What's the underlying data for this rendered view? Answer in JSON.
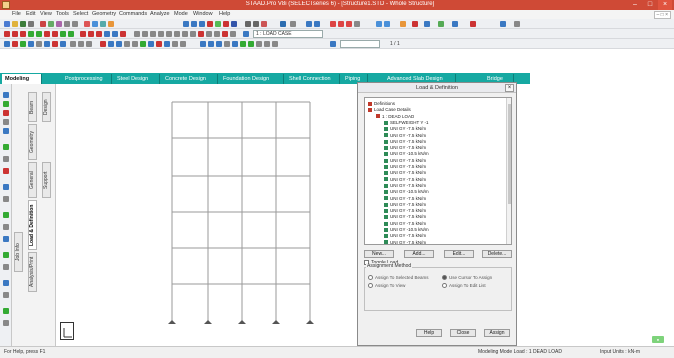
{
  "window": {
    "title": "STAAD.Pro V8i (SELECTseries 6) - [Structure1.STD - Whole Structure]",
    "controls": [
      "–",
      "□",
      "×"
    ]
  },
  "menubar": {
    "items": [
      "File",
      "Edit",
      "View",
      "Tools",
      "Select",
      "Geometry",
      "Commands",
      "Analyze",
      "Mode",
      "Window",
      "Help"
    ],
    "right_label": "– □ ×"
  },
  "toolbar": {
    "load_case_select": "1 : LOAD CASE",
    "page_select": "",
    "page_count": "1  /  1"
  },
  "tabs": {
    "items": [
      "Modeling",
      "Postprocessing",
      "Steel Design",
      "Concrete Design",
      "Foundation Design",
      "Shell Connection",
      "Piping",
      "Advanced Slab Design",
      "Bridge"
    ],
    "active_index": 0
  },
  "page_control": {
    "tabs": [
      "Job Info",
      "Beam",
      "Geometry",
      "General",
      "Support",
      "Load & Definition",
      "Analysis/Print",
      "Design"
    ],
    "active": "Load & Definition"
  },
  "dialog": {
    "title": "Load & Definition",
    "close": "×",
    "tree": [
      {
        "level": 0,
        "label": "Definitions",
        "icon": "folder"
      },
      {
        "level": 0,
        "label": "Load Case Details",
        "icon": "folder"
      },
      {
        "level": 1,
        "label": "1 : DEAD LOAD",
        "icon": "load"
      },
      {
        "level": 2,
        "label": "SELFWEIGHT Y -1",
        "icon": "check"
      },
      {
        "level": 2,
        "label": "UNI GY -7.5 kN/m",
        "icon": "check"
      },
      {
        "level": 2,
        "label": "UNI GY -7.5 kN/m",
        "icon": "check"
      },
      {
        "level": 2,
        "label": "UNI GY -7.5 kN/m",
        "icon": "check"
      },
      {
        "level": 2,
        "label": "UNI GY -7.5 kN/m",
        "icon": "check"
      },
      {
        "level": 2,
        "label": "UNI GY -10.5 kN/m",
        "icon": "check"
      },
      {
        "level": 2,
        "label": "UNI GY -7.5 kN/m",
        "icon": "check"
      },
      {
        "level": 2,
        "label": "UNI GY -7.5 kN/m",
        "icon": "check"
      },
      {
        "level": 2,
        "label": "UNI GY -7.5 kN/m",
        "icon": "check"
      },
      {
        "level": 2,
        "label": "UNI GY -7.5 kN/m",
        "icon": "check"
      },
      {
        "level": 2,
        "label": "UNI GY -7.5 kN/m",
        "icon": "check"
      },
      {
        "level": 2,
        "label": "UNI GY -10.5 kN/m",
        "icon": "check"
      },
      {
        "level": 2,
        "label": "UNI GY -7.5 kN/m",
        "icon": "check"
      },
      {
        "level": 2,
        "label": "UNI GY -7.5 kN/m",
        "icon": "check"
      },
      {
        "level": 2,
        "label": "UNI GY -7.5 kN/m",
        "icon": "check"
      },
      {
        "level": 2,
        "label": "UNI GY -7.5 kN/m",
        "icon": "check"
      },
      {
        "level": 2,
        "label": "UNI GY -7.5 kN/m",
        "icon": "check"
      },
      {
        "level": 2,
        "label": "UNI GY -10.5 kN/m",
        "icon": "check"
      },
      {
        "level": 2,
        "label": "UNI GY -7.5 kN/m",
        "icon": "check"
      },
      {
        "level": 2,
        "label": "UNI GY -7.5 kN/m",
        "icon": "check"
      }
    ],
    "buttons": {
      "new": "New...",
      "add": "Add...",
      "edit": "Edit...",
      "delete": "Delete..."
    },
    "toggle_load": "Toggle Load",
    "assign_group_title": "Assignment Method",
    "radios": [
      "Assign To Selected Beams",
      "Assign To View",
      "Use Cursor To Assign",
      "Assign To Edit List"
    ],
    "footer_buttons": {
      "help": "Help",
      "close": "Close",
      "assign": "Assign"
    }
  },
  "status": {
    "left": "For Help, press F1",
    "middle": "Modeling Mode  Load : 1 DEAD LOAD",
    "right": "Input Units : kN-m"
  },
  "colors": {
    "title_bar": "#cf4a36",
    "tab_bar": "#16a9a2",
    "structure_lines": "#9a9a9a"
  }
}
